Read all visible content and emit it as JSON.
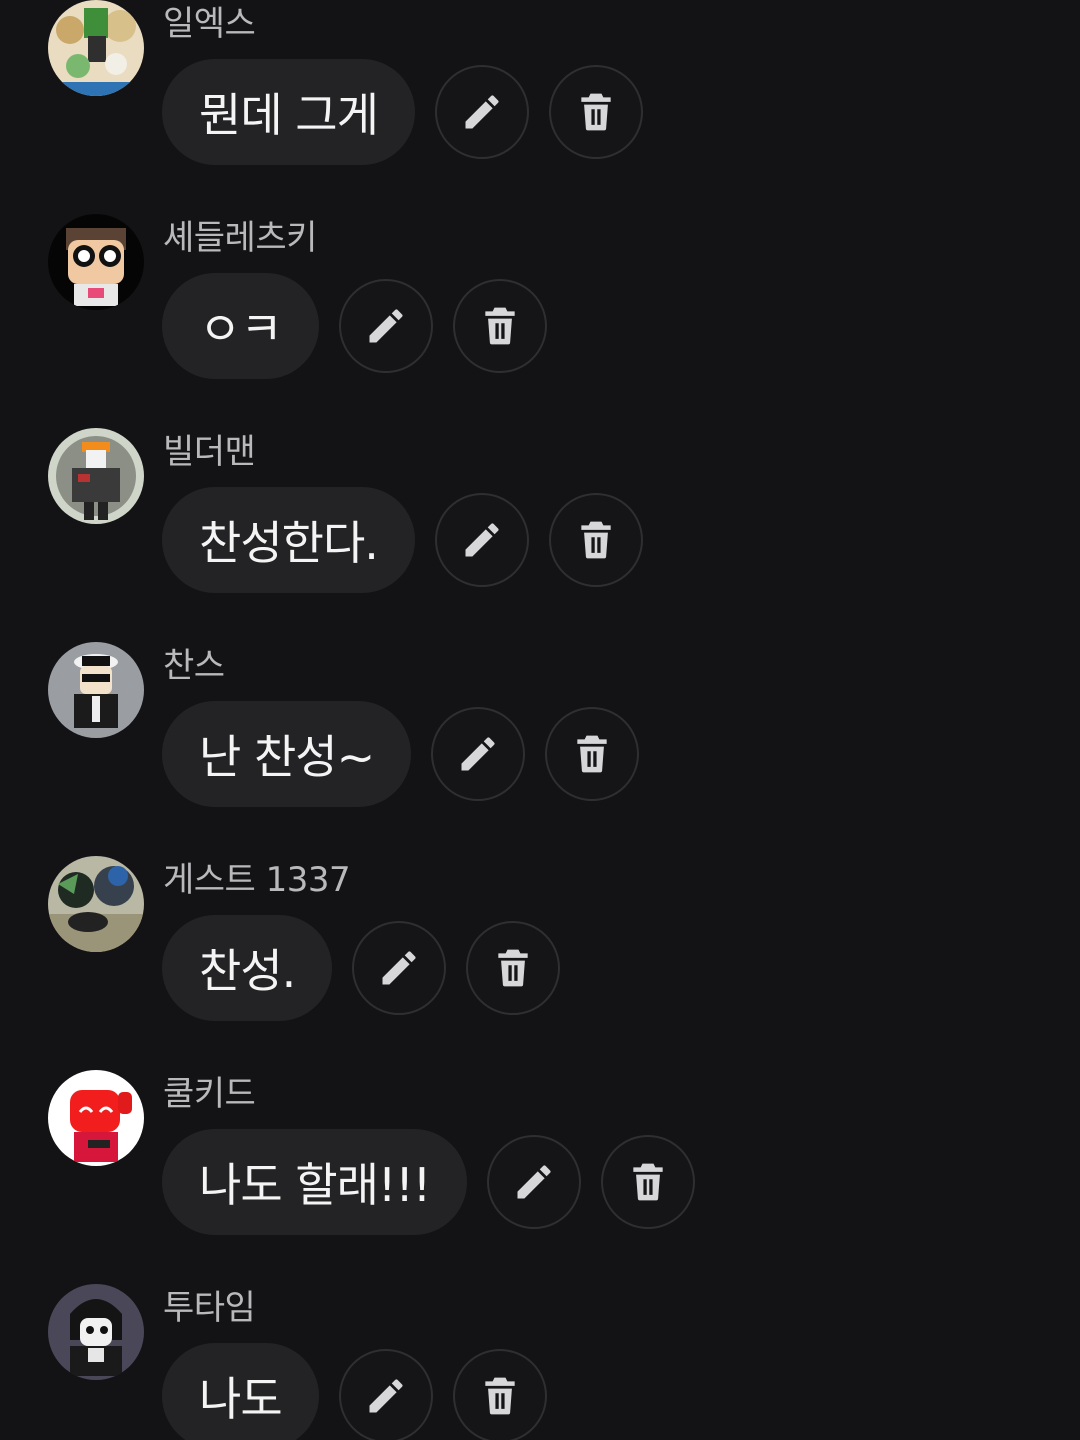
{
  "comments": [
    {
      "author": "일엑스",
      "text": "뭔데 그게",
      "avatar": "avatar-ilex"
    },
    {
      "author": "셰들레츠키",
      "text": "ㅇㅋ",
      "avatar": "avatar-shedletsky"
    },
    {
      "author": "빌더맨",
      "text": "찬성한다.",
      "avatar": "avatar-builderman"
    },
    {
      "author": "찬스",
      "text": "난 찬성~",
      "avatar": "avatar-chance"
    },
    {
      "author": "게스트 1337",
      "text": "찬성.",
      "avatar": "avatar-guest1337"
    },
    {
      "author": "쿨키드",
      "text": "나도 할래!!!",
      "avatar": "avatar-coolkid"
    },
    {
      "author": "투타임",
      "text": "나도",
      "avatar": "avatar-twotime"
    }
  ],
  "icons": {
    "edit": "pencil-icon",
    "delete": "trash-icon"
  },
  "colors": {
    "background": "#131315",
    "bubble": "#232325",
    "author": "#b9b9bc",
    "icon": "#d7d7d9"
  }
}
